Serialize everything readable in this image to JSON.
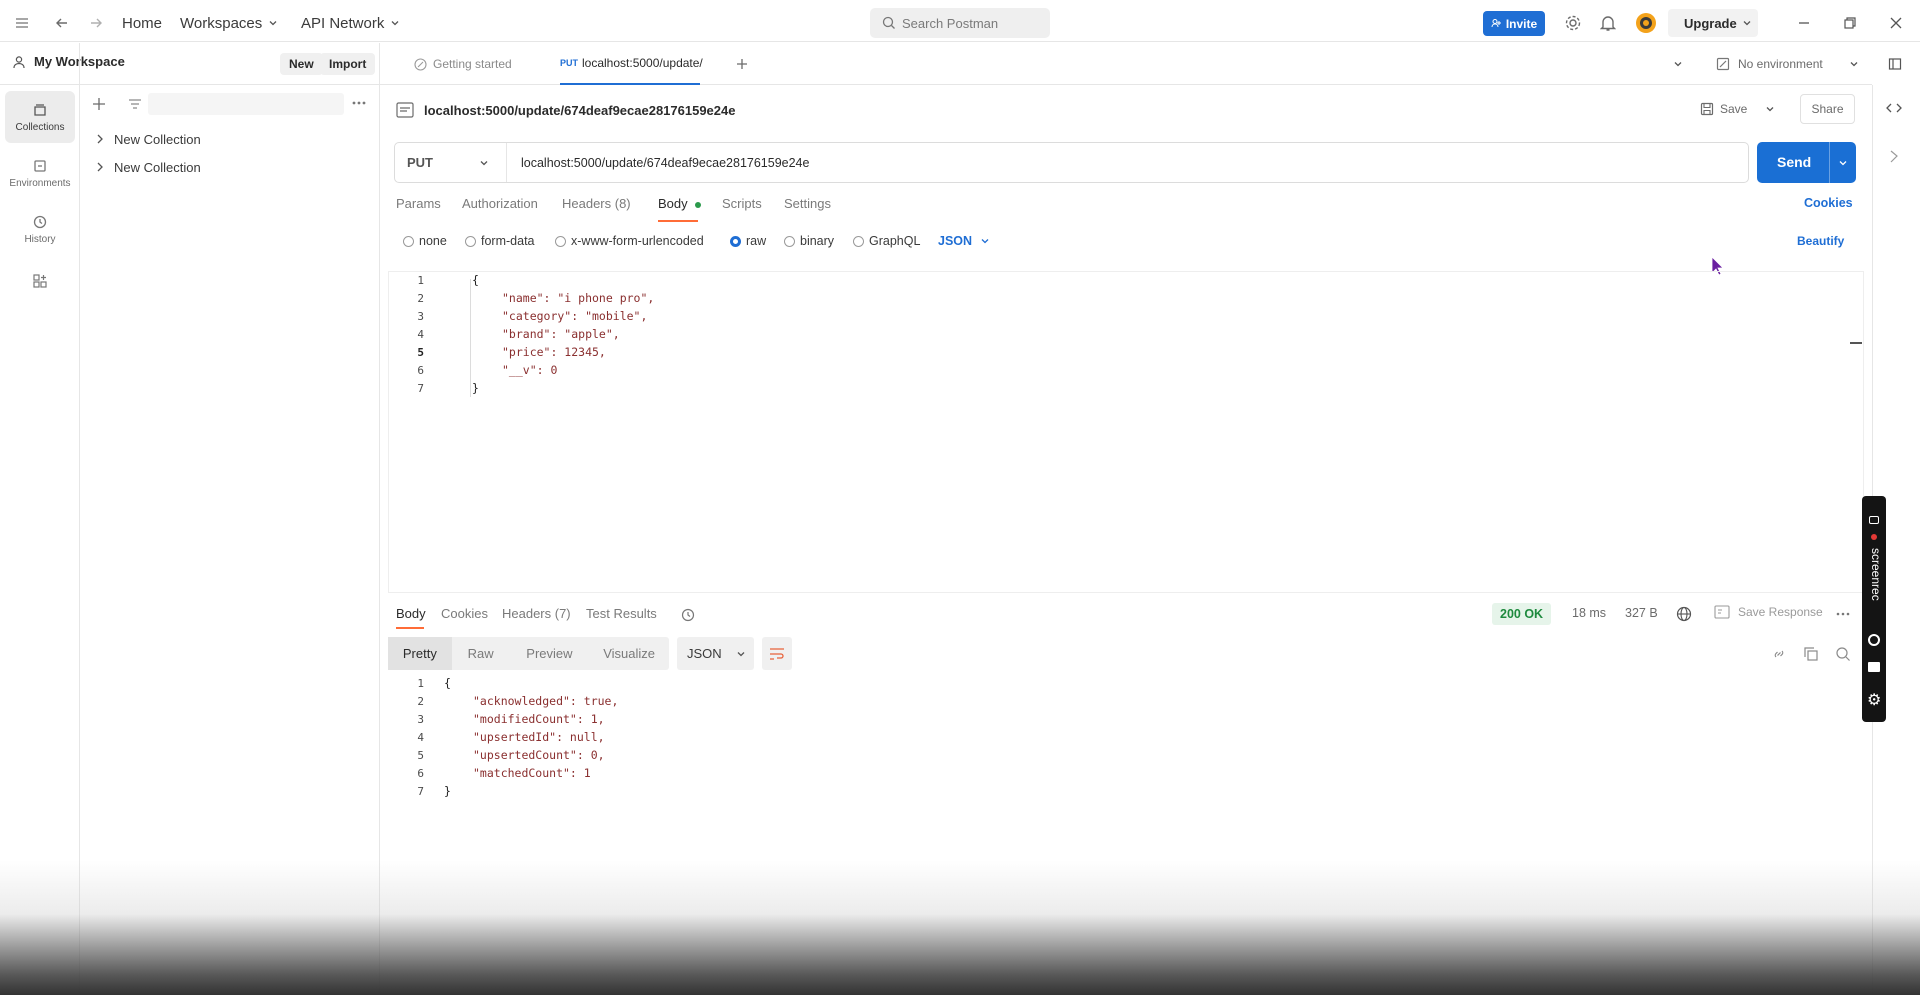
{
  "topbar": {
    "home": "Home",
    "workspaces": "Workspaces",
    "api_network": "API Network",
    "search_placeholder": "Search Postman",
    "invite": "Invite",
    "upgrade": "Upgrade"
  },
  "rail": {
    "collections": "Collections",
    "environments": "Environments",
    "history": "History"
  },
  "sidebar": {
    "workspace": "My Workspace",
    "new_btn": "New",
    "import_btn": "Import",
    "collections": [
      {
        "label": "New Collection"
      },
      {
        "label": "New Collection"
      }
    ]
  },
  "tabs": {
    "getting_started": "Getting started",
    "active_method": "PUT",
    "active_label": "localhost:5000/update/",
    "environment": "No environment"
  },
  "request": {
    "title": "localhost:5000/update/674deaf9ecae28176159e24e",
    "save": "Save",
    "share": "Share",
    "method": "PUT",
    "url": "localhost:5000/update/674deaf9ecae28176159e24e",
    "send": "Send",
    "tabs": {
      "params": "Params",
      "authorization": "Authorization",
      "headers": "Headers (8)",
      "body": "Body",
      "scripts": "Scripts",
      "settings": "Settings"
    },
    "cookies": "Cookies",
    "body_types": {
      "none": "none",
      "form_data": "form-data",
      "urlencoded": "x-www-form-urlencoded",
      "raw": "raw",
      "binary": "binary",
      "graphql": "GraphQL"
    },
    "format": "JSON",
    "beautify": "Beautify",
    "body_lines": [
      {
        "n": "1",
        "t": "{"
      },
      {
        "n": "2",
        "t": "\"name\": \"i phone pro\","
      },
      {
        "n": "3",
        "t": "\"category\": \"mobile\","
      },
      {
        "n": "4",
        "t": "\"brand\": \"apple\","
      },
      {
        "n": "5",
        "t": "\"price\": 12345,"
      },
      {
        "n": "6",
        "t": "\"__v\": 0"
      },
      {
        "n": "7",
        "t": "}"
      }
    ]
  },
  "response": {
    "tabs": {
      "body": "Body",
      "cookies": "Cookies",
      "headers": "Headers (7)",
      "test_results": "Test Results"
    },
    "status": "200 OK",
    "time": "18 ms",
    "size": "327 B",
    "save_response": "Save Response",
    "views": {
      "pretty": "Pretty",
      "raw": "Raw",
      "preview": "Preview",
      "visualize": "Visualize"
    },
    "format": "JSON",
    "lines": [
      {
        "n": "1",
        "t": "{"
      },
      {
        "n": "2",
        "t": "\"acknowledged\": true,"
      },
      {
        "n": "3",
        "t": "\"modifiedCount\": 1,"
      },
      {
        "n": "4",
        "t": "\"upsertedId\": null,"
      },
      {
        "n": "5",
        "t": "\"upsertedCount\": 0,"
      },
      {
        "n": "6",
        "t": "\"matchedCount\": 1"
      },
      {
        "n": "7",
        "t": "}"
      }
    ]
  },
  "overlay": {
    "brand": "screenrec"
  }
}
